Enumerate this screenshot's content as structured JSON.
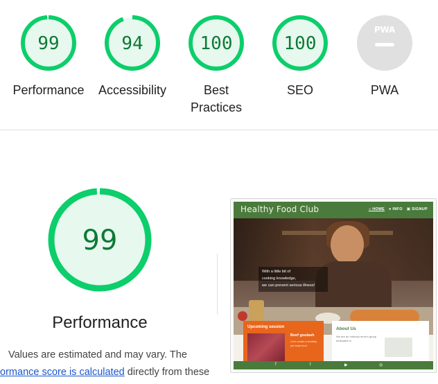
{
  "gauges": [
    {
      "score": "99",
      "label": "Performance",
      "level": 0.99
    },
    {
      "score": "94",
      "label": "Accessibility",
      "level": 0.94
    },
    {
      "score": "100",
      "label": "Best Practices",
      "level": 1.0
    },
    {
      "score": "100",
      "label": "SEO",
      "level": 1.0
    },
    {
      "label": "PWA",
      "badge_text": "PWA"
    }
  ],
  "performance_section": {
    "score": "99",
    "title": "Performance",
    "desc_line1": "Values are estimated and may vary. The",
    "desc_link": "formance score is calculated",
    "desc_line2_rest": " directly from these"
  },
  "site_preview": {
    "brand": "Healthy Food Club",
    "nav": [
      "⌂ HOME",
      "● INFO",
      "▣ SIGNUP"
    ],
    "hero_lines": [
      "With a little bit of",
      "cooking knowledge,",
      "we can prevent serious illness!"
    ],
    "upcoming_title": "Upcoming session",
    "session_title": "Beef goulash",
    "session_text": "Let's create a healthy, yet tasty food",
    "about_title": "About Us",
    "about_text": "We are an ordinary mum's group dedicated to",
    "footer_icons": [
      "f",
      "t",
      "▶",
      "◎"
    ]
  },
  "colors": {
    "gauge_green": "#0cce6b",
    "gauge_fill": "#e7f8ee",
    "score_text": "#0c7a36",
    "pwa_gray": "#e0e0e0",
    "site_green": "#4a7b3c",
    "session_orange": "#e8651c",
    "link_blue": "#1a56c8"
  }
}
